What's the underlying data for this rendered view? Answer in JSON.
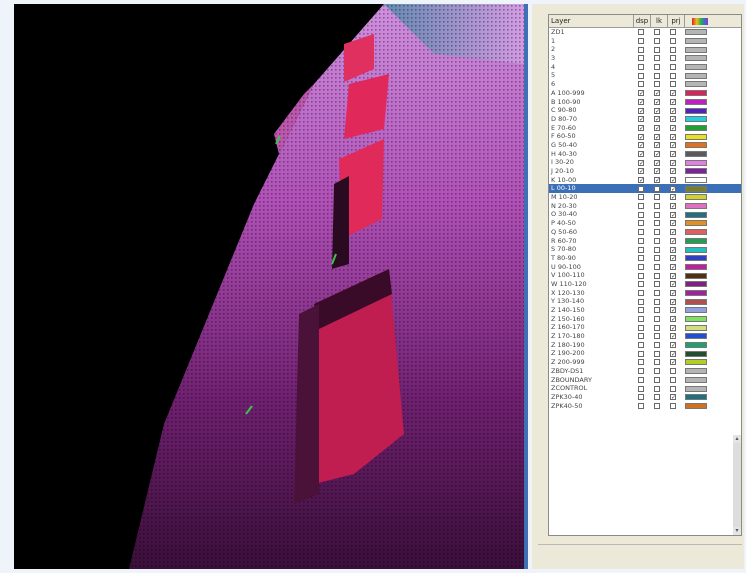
{
  "table": {
    "headers": {
      "name": "Layer",
      "c1": "dsp",
      "c2": "lk",
      "c3": "prj",
      "c4": "col"
    },
    "rows": [
      {
        "name": "ZD1",
        "dsp": false,
        "lk": false,
        "prj": false,
        "color": "#b5b5b5"
      },
      {
        "name": "1",
        "dsp": false,
        "lk": false,
        "prj": false,
        "color": "#b5b5b5"
      },
      {
        "name": "2",
        "dsp": false,
        "lk": false,
        "prj": false,
        "color": "#b5b5b5"
      },
      {
        "name": "3",
        "dsp": false,
        "lk": false,
        "prj": false,
        "color": "#b5b5b5"
      },
      {
        "name": "4",
        "dsp": false,
        "lk": false,
        "prj": false,
        "color": "#b5b5b5"
      },
      {
        "name": "5",
        "dsp": false,
        "lk": false,
        "prj": false,
        "color": "#b5b5b5"
      },
      {
        "name": "6",
        "dsp": false,
        "lk": false,
        "prj": false,
        "color": "#b5b5b5"
      },
      {
        "name": "A 100-999",
        "dsp": true,
        "lk": true,
        "prj": true,
        "color": "#e0205a"
      },
      {
        "name": "B 100-90",
        "dsp": true,
        "lk": true,
        "prj": true,
        "color": "#c020c0"
      },
      {
        "name": "C 90-80",
        "dsp": true,
        "lk": true,
        "prj": true,
        "color": "#5020c0"
      },
      {
        "name": "D 80-70",
        "dsp": true,
        "lk": true,
        "prj": true,
        "color": "#20d0e0"
      },
      {
        "name": "E 70-60",
        "dsp": true,
        "lk": true,
        "prj": true,
        "color": "#20a030"
      },
      {
        "name": "F 60-50",
        "dsp": true,
        "lk": true,
        "prj": true,
        "color": "#e8e020"
      },
      {
        "name": "G 50-40",
        "dsp": true,
        "lk": true,
        "prj": true,
        "color": "#e07020"
      },
      {
        "name": "H 40-30",
        "dsp": true,
        "lk": true,
        "prj": true,
        "color": "#5a5a5a"
      },
      {
        "name": "I 30-20",
        "dsp": true,
        "lk": true,
        "prj": true,
        "color": "#e080e0"
      },
      {
        "name": "J 20-10",
        "dsp": true,
        "lk": true,
        "prj": true,
        "color": "#8020a0"
      },
      {
        "name": "K 10-00",
        "dsp": true,
        "lk": true,
        "prj": true,
        "color": "#ffffff"
      },
      {
        "name": "L 00-10",
        "dsp": false,
        "lk": false,
        "prj": true,
        "color": "#7a8020",
        "selected": true
      },
      {
        "name": "M 10-20",
        "dsp": false,
        "lk": false,
        "prj": true,
        "color": "#d0d030"
      },
      {
        "name": "N 20-30",
        "dsp": false,
        "lk": false,
        "prj": true,
        "color": "#e070c0"
      },
      {
        "name": "O 30-40",
        "dsp": false,
        "lk": false,
        "prj": true,
        "color": "#207080"
      },
      {
        "name": "P 40-50",
        "dsp": false,
        "lk": false,
        "prj": true,
        "color": "#e09020"
      },
      {
        "name": "Q 50-60",
        "dsp": false,
        "lk": false,
        "prj": true,
        "color": "#e06060"
      },
      {
        "name": "R 60-70",
        "dsp": false,
        "lk": false,
        "prj": true,
        "color": "#20a050"
      },
      {
        "name": "S 70-80",
        "dsp": false,
        "lk": false,
        "prj": true,
        "color": "#20c0c0"
      },
      {
        "name": "T 80-90",
        "dsp": false,
        "lk": false,
        "prj": true,
        "color": "#3040c0"
      },
      {
        "name": "U 90-100",
        "dsp": false,
        "lk": false,
        "prj": true,
        "color": "#c020a0"
      },
      {
        "name": "V 100-110",
        "dsp": false,
        "lk": false,
        "prj": true,
        "color": "#503010"
      },
      {
        "name": "W 110-120",
        "dsp": false,
        "lk": false,
        "prj": true,
        "color": "#802080"
      },
      {
        "name": "X 120-130",
        "dsp": false,
        "lk": false,
        "prj": true,
        "color": "#a020a0"
      },
      {
        "name": "Y 130-140",
        "dsp": false,
        "lk": false,
        "prj": true,
        "color": "#b05050"
      },
      {
        "name": "Z 140-150",
        "dsp": false,
        "lk": false,
        "prj": true,
        "color": "#90a0e0"
      },
      {
        "name": "Z 150-160",
        "dsp": false,
        "lk": false,
        "prj": true,
        "color": "#80e060"
      },
      {
        "name": "Z 160-170",
        "dsp": false,
        "lk": false,
        "prj": true,
        "color": "#d0e080"
      },
      {
        "name": "Z 170-180",
        "dsp": false,
        "lk": false,
        "prj": true,
        "color": "#2050d0"
      },
      {
        "name": "Z 180-190",
        "dsp": false,
        "lk": false,
        "prj": true,
        "color": "#20a070"
      },
      {
        "name": "Z 190-200",
        "dsp": false,
        "lk": false,
        "prj": true,
        "color": "#205030"
      },
      {
        "name": "Z 200-999",
        "dsp": false,
        "lk": false,
        "prj": true,
        "color": "#b0d020"
      },
      {
        "name": "ZBDY-DS1",
        "dsp": false,
        "lk": false,
        "prj": false,
        "color": "#b5b5b5"
      },
      {
        "name": "ZBOUNDARY",
        "dsp": false,
        "lk": false,
        "prj": false,
        "color": "#b5b5b5"
      },
      {
        "name": "ZCONTROL",
        "dsp": false,
        "lk": false,
        "prj": false,
        "color": "#b5b5b5"
      },
      {
        "name": "ZPK30-40",
        "dsp": false,
        "lk": false,
        "prj": true,
        "color": "#207080"
      },
      {
        "name": "ZPK40-50",
        "dsp": false,
        "lk": false,
        "prj": false,
        "color": "#d07020"
      }
    ]
  },
  "icons": {
    "check": "✓",
    "scroll_up": "▴",
    "scroll_down": "▾",
    "color_header_icon": "rainbow-icon"
  }
}
